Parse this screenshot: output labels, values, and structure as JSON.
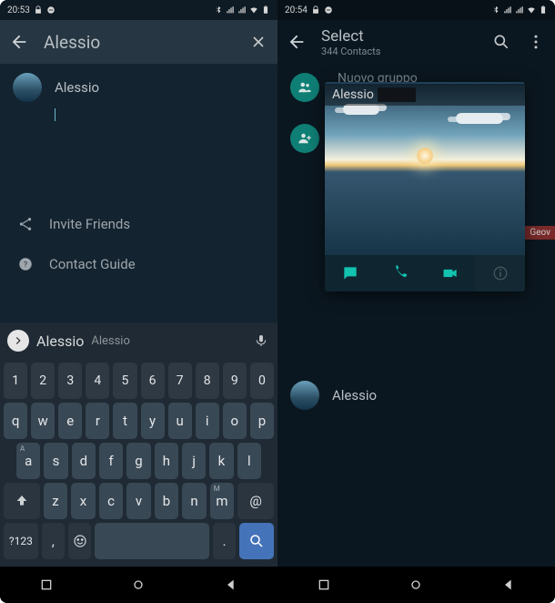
{
  "left": {
    "status_time": "20:53",
    "search_value": "Alessio",
    "contact": {
      "name": "Alessio"
    },
    "menu": {
      "invite_label": "Invite Friends",
      "guide_label": "Contact Guide"
    },
    "keyboard": {
      "suggestion_primary": "Alessio",
      "suggestion_secondary": "Alessio",
      "num_row": [
        "1",
        "2",
        "3",
        "4",
        "5",
        "6",
        "7",
        "8",
        "9",
        "0"
      ],
      "row1": [
        "q",
        "w",
        "e",
        "r",
        "t",
        "y",
        "u",
        "i",
        "o",
        "p"
      ],
      "row2": [
        "a",
        "s",
        "d",
        "f",
        "g",
        "h",
        "j",
        "k",
        "l"
      ],
      "row3": [
        "z",
        "x",
        "c",
        "v",
        "b",
        "n",
        "m"
      ],
      "shift_up_hint": "A",
      "row_m_hint": "M",
      "at_key": "@",
      "mode_key": "?123",
      "comma_key": ",",
      "period_key": "."
    }
  },
  "right": {
    "status_time": "20:54",
    "title": "Select",
    "subtitle": "344 Contacts",
    "group_label": "Nuovo gruppo",
    "side_label": "Geov",
    "popup": {
      "name": "Alessio"
    },
    "lower_contact": "Alessio"
  },
  "colors": {
    "accent": "#12c3b0",
    "search_btn": "#4573b9"
  }
}
